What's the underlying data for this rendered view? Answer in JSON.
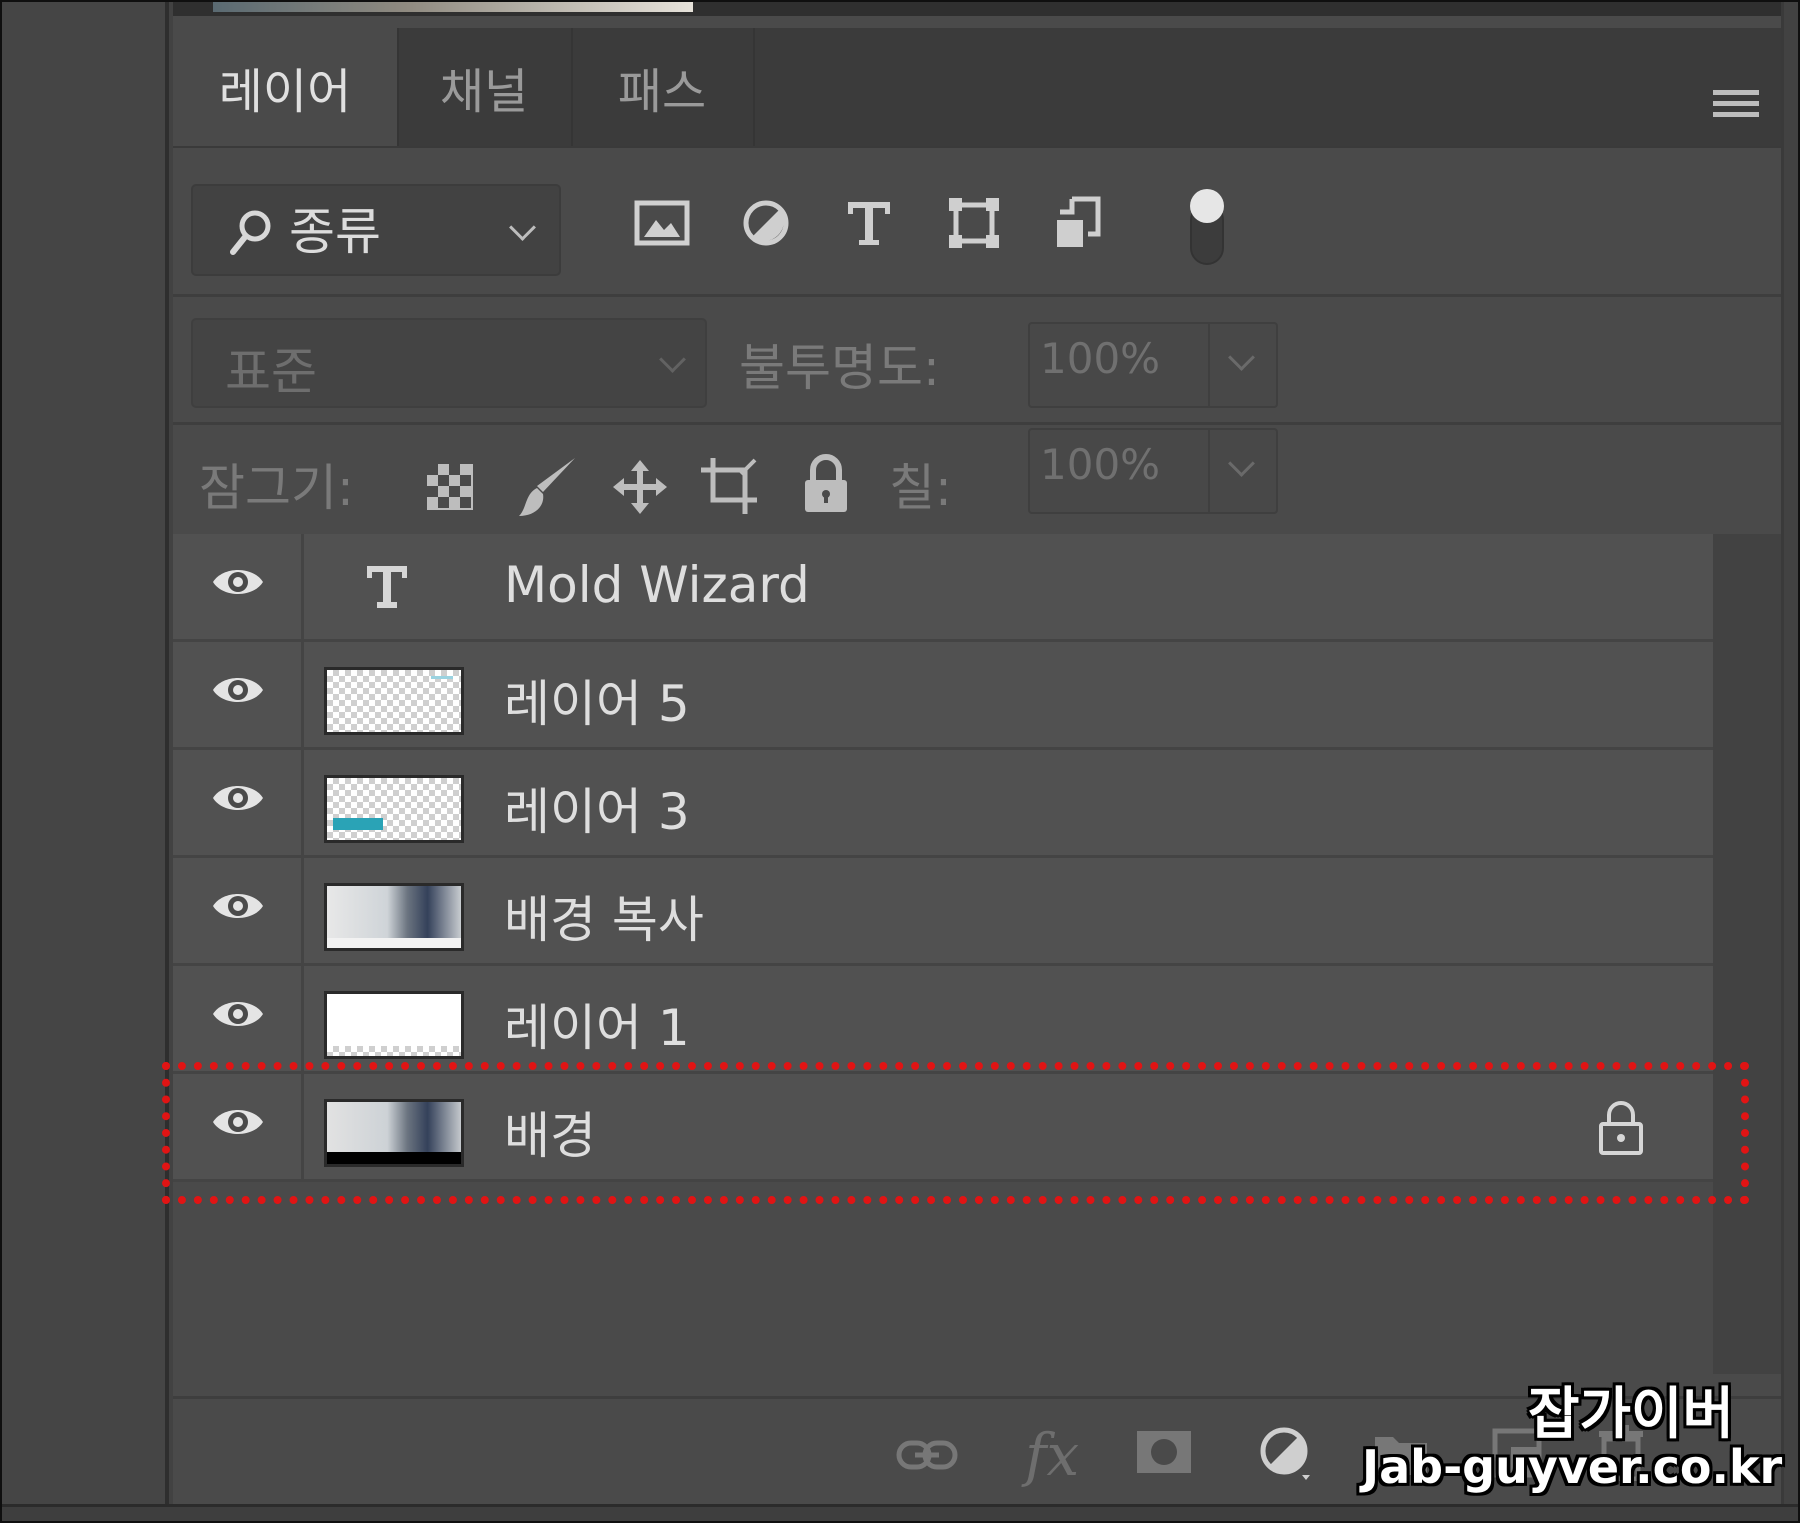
{
  "tabs": [
    {
      "label": "레이어",
      "active": true
    },
    {
      "label": "채널",
      "active": false
    },
    {
      "label": "패스",
      "active": false
    }
  ],
  "filter": {
    "kind_label": "종류",
    "icons": [
      "image-filter-icon",
      "adjustment-filter-icon",
      "type-filter-icon",
      "shape-filter-icon",
      "smart-object-filter-icon",
      "filter-toggle-icon"
    ]
  },
  "blend": {
    "mode": "표준",
    "opacity_label": "불투명도:",
    "opacity_value": "100%"
  },
  "lock": {
    "label": "잠그기:",
    "fill_label": "칠:",
    "fill_value": "100%"
  },
  "layers": [
    {
      "name": "Mold Wizard",
      "type": "text",
      "visible": true,
      "locked": false
    },
    {
      "name": "레이어 5",
      "type": "pixel",
      "visible": true,
      "locked": false
    },
    {
      "name": "레이어 3",
      "type": "pixel",
      "visible": true,
      "locked": false
    },
    {
      "name": "배경 복사",
      "type": "photo",
      "visible": true,
      "locked": false
    },
    {
      "name": "레이어 1",
      "type": "white",
      "visible": true,
      "locked": false
    },
    {
      "name": "배경",
      "type": "photo-bg",
      "visible": true,
      "locked": true,
      "highlighted": true
    }
  ],
  "footer_icons": [
    "link-icon",
    "fx-icon",
    "mask-icon",
    "adjustment-layer-icon",
    "folder-icon",
    "new-layer-icon",
    "trash-icon"
  ],
  "watermark": {
    "title": "잡가이버",
    "url": "Jab-guyver.co.kr"
  },
  "colors": {
    "panel": "#4a4a4a",
    "highlight": "#e11414",
    "text": "#dedede"
  }
}
